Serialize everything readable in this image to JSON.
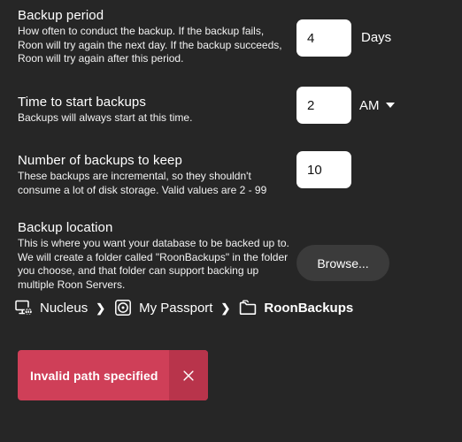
{
  "settings": [
    {
      "title": "Backup period",
      "description": "How often to conduct the backup. If the backup fails, Roon will try again the next day. If the backup succeeds, Roon will try again after this period.",
      "value": "4",
      "unit": "Days"
    },
    {
      "title": "Time to start backups",
      "description": "Backups will always start at this time.",
      "value": "2",
      "meridiem": "AM"
    },
    {
      "title": "Number of backups to keep",
      "description": "These backups are incremental, so they shouldn't consume a lot of disk storage. Valid values are 2 - 99",
      "value": "10"
    },
    {
      "title": "Backup location",
      "description": "This is where you want your database to be backed up to. We will create a folder called \"RoonBackups\" in the folder you choose, and that folder can support backing up multiple Roon Servers.",
      "browse_label": "Browse..."
    }
  ],
  "breadcrumb": {
    "separator": "❯",
    "items": [
      {
        "label": "Nucleus",
        "icon": "server-icon"
      },
      {
        "label": "My Passport",
        "icon": "disk-icon"
      },
      {
        "label": "RoonBackups",
        "icon": "folder-icon"
      }
    ]
  },
  "error_banner": {
    "message": "Invalid path specified",
    "close_icon": "close-icon",
    "background_color": "#cf3f58",
    "close_background_color": "#b8344b"
  },
  "theme": {
    "background_color": "#262626",
    "text_color": "#ffffff",
    "button_color": "#3b3b3b"
  }
}
